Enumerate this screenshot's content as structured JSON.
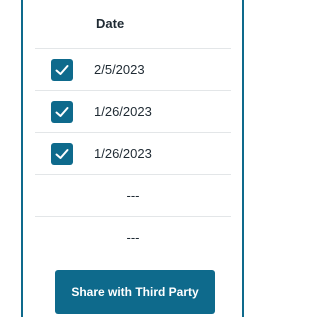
{
  "table": {
    "header": "Date",
    "rows": [
      {
        "checked": true,
        "date": "2/5/2023"
      },
      {
        "checked": true,
        "date": "1/26/2023"
      },
      {
        "checked": true,
        "date": "1/26/2023"
      },
      {
        "checked": false,
        "date": "---"
      },
      {
        "checked": false,
        "date": "---"
      }
    ]
  },
  "share_button": {
    "label": "Share with Third Party"
  },
  "colors": {
    "accent": "#0e6a8c",
    "text": "#1f2a33",
    "divider": "#e3e6e8"
  },
  "icons": {
    "checkbox": "checkmark-icon"
  }
}
